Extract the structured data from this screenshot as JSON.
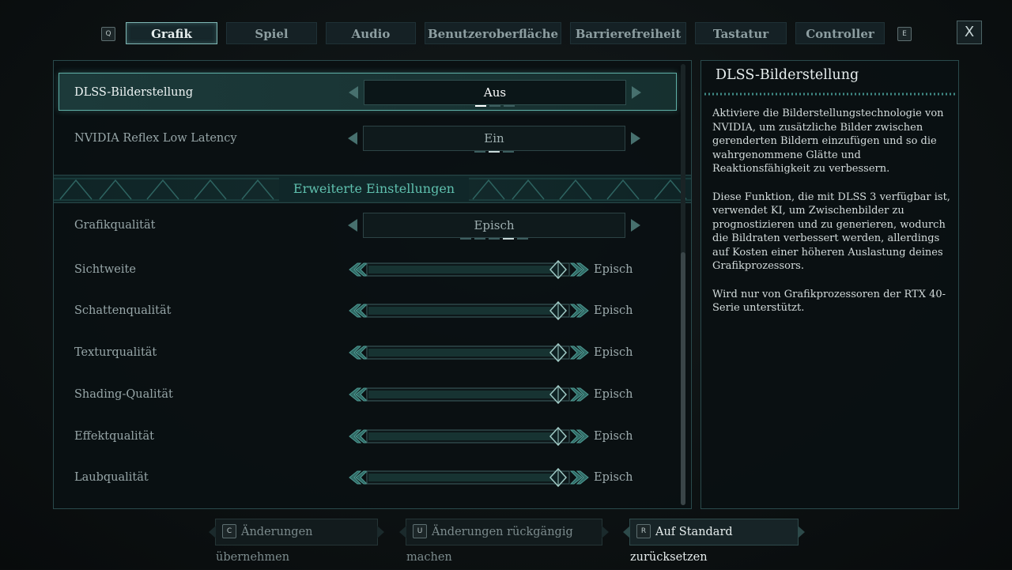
{
  "tabs": {
    "prev_key": "Q",
    "next_key": "E",
    "close_label": "X",
    "items": [
      "Grafik",
      "Spiel",
      "Audio",
      "Benutzeroberfläche",
      "Barrierefreiheit",
      "Tastatur",
      "Controller"
    ],
    "active": "Grafik"
  },
  "settings": {
    "dlss": {
      "label": "DLSS-Bilderstellung",
      "value": "Aus",
      "option_count": 3,
      "selected_index": 0
    },
    "reflex": {
      "label": "NVIDIA Reflex Low Latency",
      "value": "Ein",
      "option_count": 3,
      "selected_index": 1
    },
    "section_title": "Erweiterte Einstellungen",
    "quality": {
      "label": "Grafikqualität",
      "value": "Episch",
      "option_count": 5,
      "selected_index": 3
    },
    "sliders": [
      {
        "label": "Sichtweite",
        "value": "Episch",
        "level": 1.0
      },
      {
        "label": "Schattenqualität",
        "value": "Episch",
        "level": 1.0
      },
      {
        "label": "Texturqualität",
        "value": "Episch",
        "level": 1.0
      },
      {
        "label": "Shading-Qualität",
        "value": "Episch",
        "level": 1.0
      },
      {
        "label": "Effektqualität",
        "value": "Episch",
        "level": 1.0
      },
      {
        "label": "Laubqualität",
        "value": "Episch",
        "level": 1.0
      }
    ]
  },
  "info": {
    "title": "DLSS-Bilderstellung",
    "paragraphs": [
      "Aktiviere die Bilderstellungstechnologie von NVIDIA, um zusätzliche Bilder zwischen gerenderten Bildern einzufügen und so die wahrgenommene Glätte und Reaktionsfähigkeit zu verbessern.",
      "Diese Funktion, die mit DLSS 3 verfügbar ist, verwendet KI, um Zwischenbilder zu prognostizieren und zu generieren, wodurch die Bildraten verbessert werden, allerdings auf Kosten einer höheren Auslastung deines Grafikprozessors.",
      "Wird nur von Grafikprozessoren der RTX 40-Serie unterstützt."
    ]
  },
  "footer": {
    "apply": {
      "key": "C",
      "label": "Änderungen übernehmen"
    },
    "undo": {
      "key": "U",
      "label": "Änderungen rückgängig machen"
    },
    "reset": {
      "key": "R",
      "label": "Auf Standard zurücksetzen"
    }
  },
  "colors": {
    "accent": "#5fb0a7",
    "section_text": "#5fc0ae",
    "background": "#0d1213"
  }
}
